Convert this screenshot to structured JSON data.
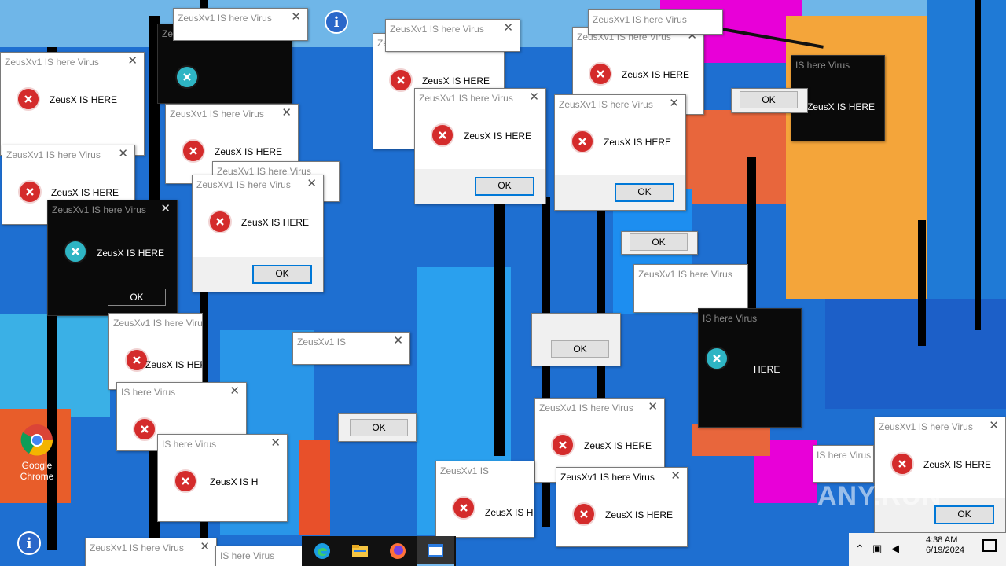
{
  "window_title": "ZeusXv1 IS here Virus",
  "message": "ZeusX IS HERE",
  "ok_label": "OK",
  "dialogs": [
    {
      "title": "ZeusXv1 IS here Virus",
      "message": "ZeusX IS HERE",
      "ok": "OK"
    }
  ],
  "fragments": {
    "partial_title_1": "IS here Virus",
    "partial_title_2": "ZeusXv1 IS",
    "partial_title_3": "Virus",
    "partial_msg_1": "ZeusX IS HERE",
    "partial_msg_2": "ZeusX IS H",
    "partial_msg_3": "HERE"
  },
  "desktop_icons": [
    {
      "label": "Google Chrome",
      "icon": "chrome-icon"
    }
  ],
  "taskbar": {
    "items": [
      "edge-icon",
      "file-explorer-icon",
      "firefox-icon",
      "active-app-icon"
    ]
  },
  "tray": {
    "time": "4:38 AM",
    "date": "6/19/2024"
  },
  "watermark": "ANY.RUN",
  "colors": {
    "desktop_blue": "#1e6fd1",
    "error_red": "#d42b2b",
    "dark_dialog": "#0a0a0a",
    "accent_focus": "#0078d7",
    "glitch_orange": "#f4a53a",
    "glitch_magenta": "#e800d8"
  }
}
